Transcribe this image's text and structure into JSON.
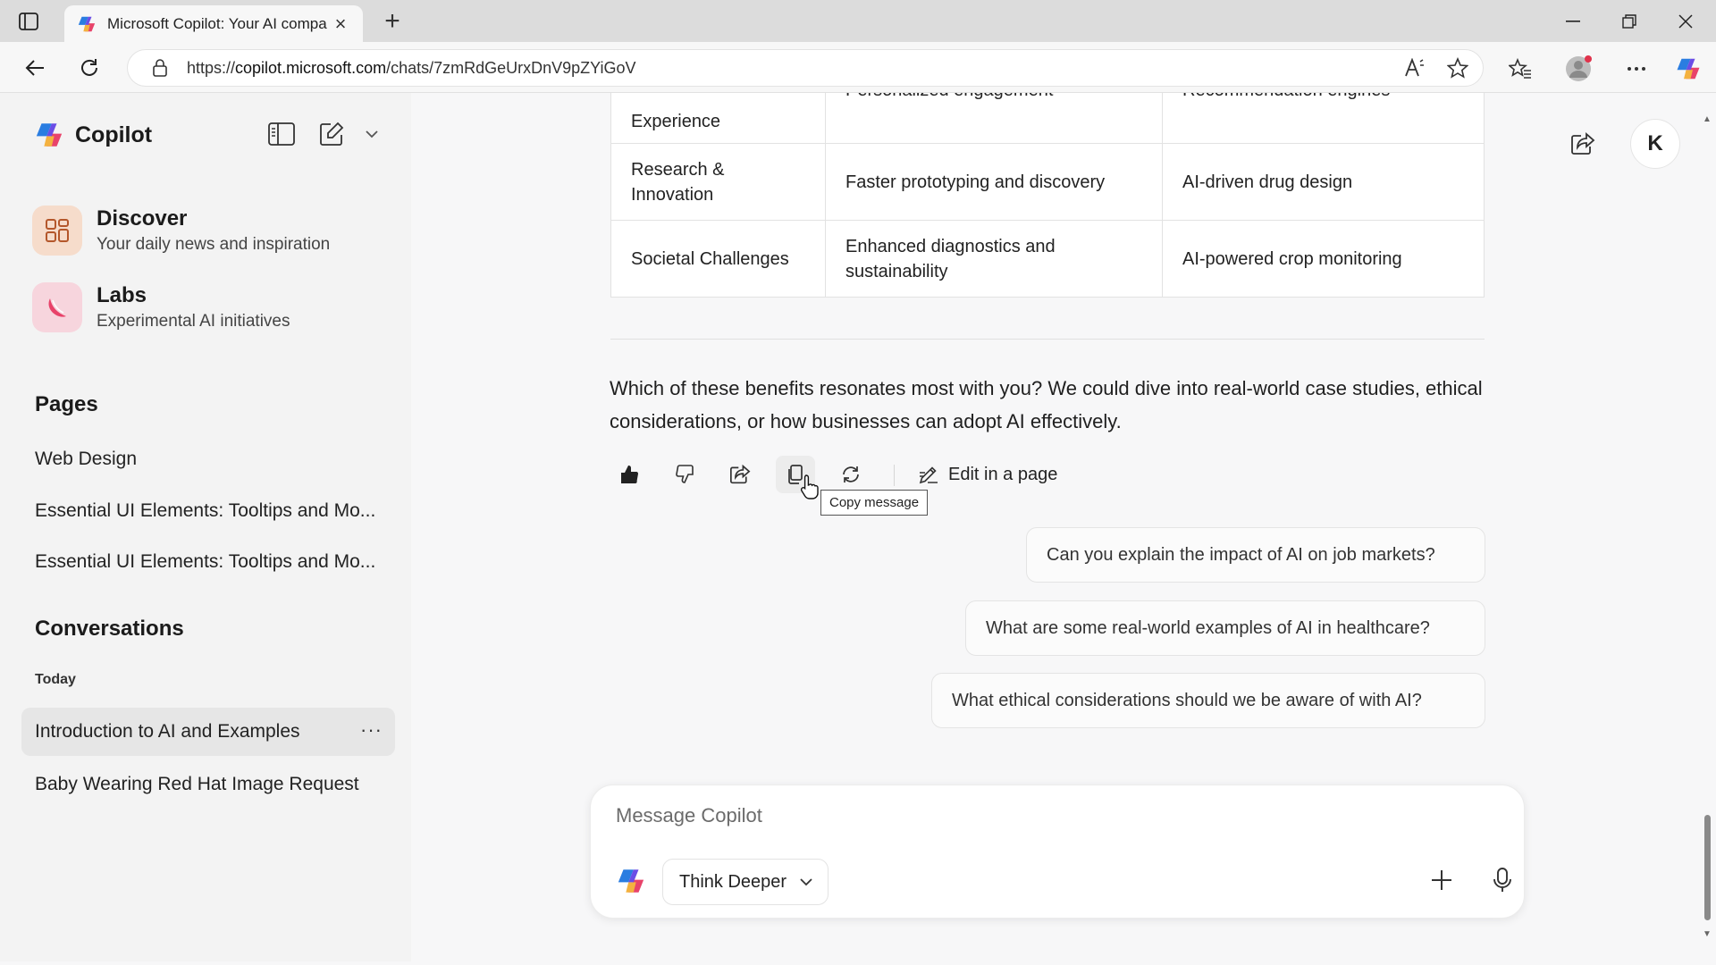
{
  "browser": {
    "tab_title": "Microsoft Copilot: Your AI compa",
    "url_prefix": "https://",
    "url_host": "copilot.microsoft.com",
    "url_path": "/chats/7zmRdGeUrxDnV9pZYiGoV"
  },
  "sidebar": {
    "brand": "Copilot",
    "features": [
      {
        "title": "Discover",
        "subtitle": "Your daily news and inspiration"
      },
      {
        "title": "Labs",
        "subtitle": "Experimental AI initiatives"
      }
    ],
    "pages_heading": "Pages",
    "pages": [
      "Web Design",
      "Essential UI Elements: Tooltips and Mo...",
      "Essential UI Elements: Tooltips and Mo..."
    ],
    "conversations_heading": "Conversations",
    "today_label": "Today",
    "conversations": [
      "Introduction to AI and Examples",
      "Baby Wearing Red Hat Image Request"
    ],
    "more_label": "···"
  },
  "main": {
    "avatar_initial": "K",
    "table_rows": [
      {
        "area": "Experience",
        "benefit": "Personalized engagement",
        "example": "Recommendation engines"
      },
      {
        "area": "Research & Innovation",
        "benefit": "Faster prototyping and discovery",
        "example": "AI-driven drug design"
      },
      {
        "area": "Societal Challenges",
        "benefit": "Enhanced diagnostics and sustainability",
        "example": "AI-powered crop monitoring"
      }
    ],
    "message": "Which of these benefits resonates most with you? We could dive into real-world case studies, ethical considerations, or how businesses can adopt AI effectively.",
    "edit_in_page": "Edit in a page",
    "tooltip": "Copy message",
    "suggestions": [
      "Can you explain the impact of AI on job markets?",
      "What are some real-world examples of AI in healthcare?",
      "What ethical considerations should we be aware of with AI?"
    ],
    "composer": {
      "placeholder": "Message Copilot",
      "mode": "Think Deeper"
    }
  },
  "colors": {
    "discover_bg": "#f6dccb",
    "labs_bg": "#f7d5dd",
    "accent_pink": "#e8436a"
  }
}
